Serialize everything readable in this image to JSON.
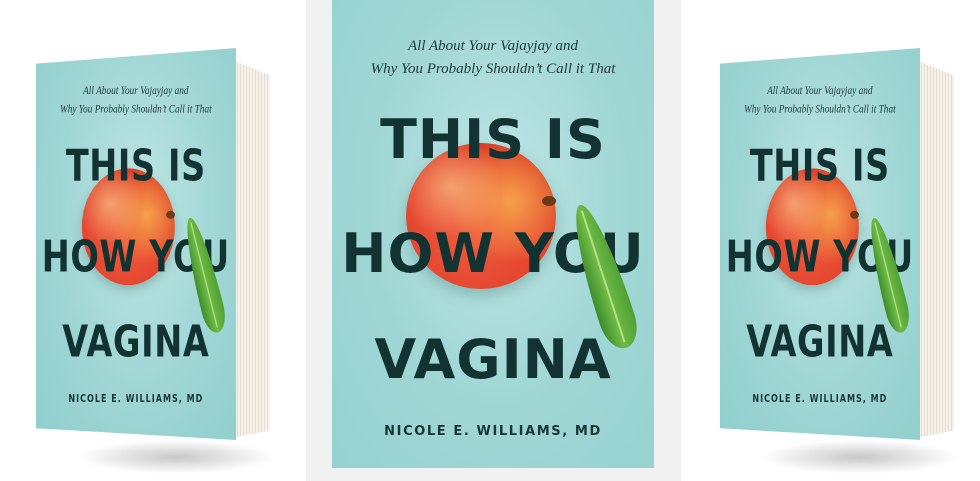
{
  "cover": {
    "subtitle_line1": "All About Your Vajayjay and",
    "subtitle_line2": "Why You Probably Shouldn’t Call it That",
    "title_line1": "THIS IS",
    "title_line2": "HOW YOU",
    "title_line3": "VAGINA",
    "author": "NICOLE E. WILLIAMS, MD"
  },
  "colors": {
    "cover_background": "#9fd6d4",
    "title_text": "#133333",
    "peach": "#e4462f",
    "leaf": "#4f9f34"
  }
}
